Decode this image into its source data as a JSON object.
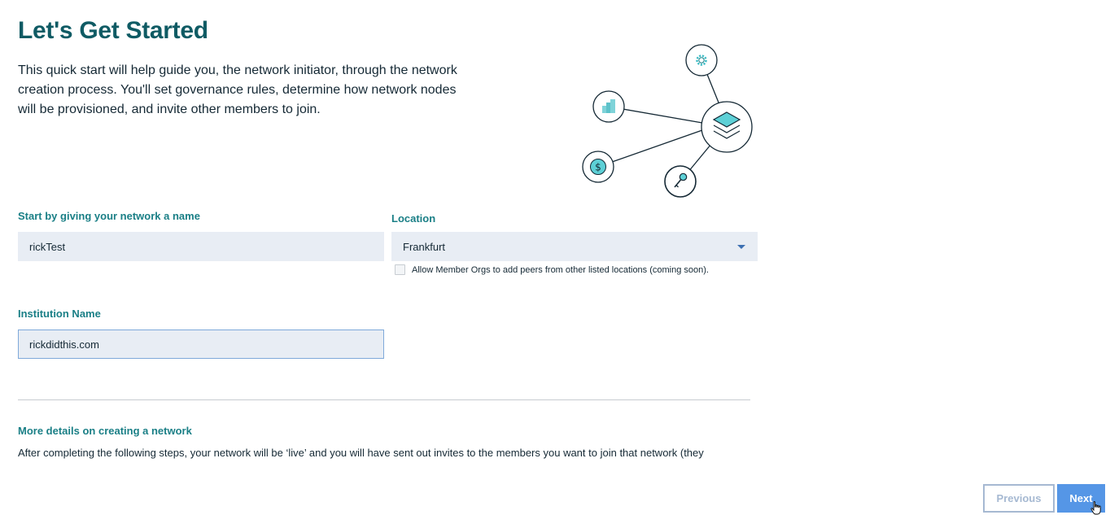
{
  "header": {
    "title": "Let's Get Started",
    "intro": "This quick start will help guide you, the network initiator, through the network creation process. You'll set governance rules, determine how network nodes will be provisioned, and invite other members to join."
  },
  "form": {
    "network_name": {
      "label": "Start by giving your network a name",
      "value": "rickTest"
    },
    "location": {
      "label": "Location",
      "selected": "Frankfurt",
      "checkbox_label": "Allow Member Orgs to add peers from other listed locations (coming soon).",
      "checkbox_checked": false
    },
    "institution": {
      "label": "Institution Name",
      "value": "rickdidthis.com"
    }
  },
  "details": {
    "heading": "More details on creating a network",
    "text": "After completing the following steps, your network will be ‘live’ and you will have sent out invites to the members you want to join that network (they"
  },
  "footer": {
    "previous_label": "Previous",
    "next_label": "Next"
  },
  "illustration": {
    "icons": [
      "gear-icon",
      "building-icon",
      "layers-icon",
      "dollar-icon",
      "key-icon"
    ]
  },
  "colors": {
    "heading": "#0f5b64",
    "label": "#1a7f86",
    "input_bg": "#e8edf4",
    "primary": "#5596e6",
    "secondary_border": "#a6b9d2"
  }
}
